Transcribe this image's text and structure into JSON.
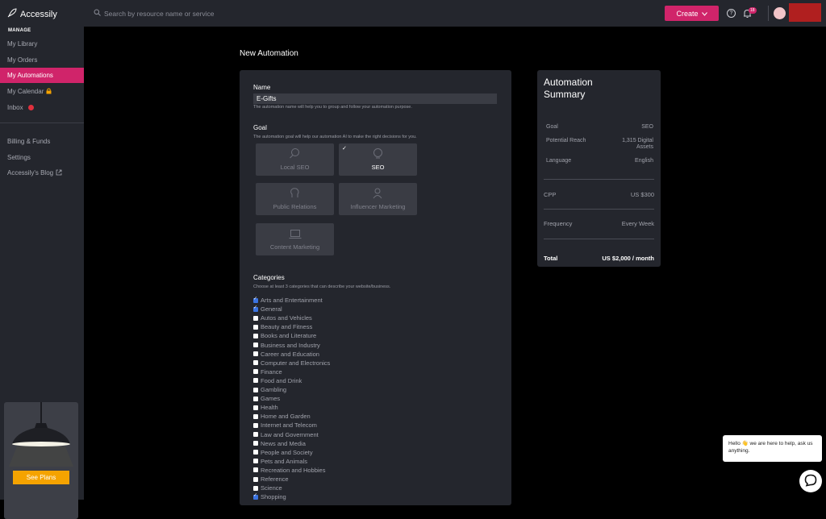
{
  "brand": {
    "name": "Accessily"
  },
  "search": {
    "placeholder": "Search by resource name or service"
  },
  "header": {
    "create_label": "Create",
    "notifications_count": "18"
  },
  "sidebar": {
    "section_label": "MANAGE",
    "items": [
      {
        "label": "My Library"
      },
      {
        "label": "My Orders"
      },
      {
        "label": "My Automations",
        "active": true
      },
      {
        "label": "My Calendar"
      },
      {
        "label": "Inbox"
      }
    ],
    "secondary_items": [
      {
        "label": "Billing & Funds"
      },
      {
        "label": "Settings"
      },
      {
        "label": "Accessily's Blog"
      }
    ],
    "promo_button": "See Plans"
  },
  "page": {
    "title": "New Automation"
  },
  "form": {
    "name_label": "Name",
    "name_value": "E-Gifts",
    "name_hint": "The automation name will help you to group and follow your automation purpose.",
    "goal_label": "Goal",
    "goal_hint": "The automation goal will help our automation AI to make the right decisions for you.",
    "goals": [
      {
        "label": "Local SEO",
        "selected": false
      },
      {
        "label": "SEO",
        "selected": true
      },
      {
        "label": "Public Relations",
        "selected": false
      },
      {
        "label": "Influencer Marketing",
        "selected": false
      },
      {
        "label": "Content Marketing",
        "selected": false
      }
    ],
    "categories_label": "Categories",
    "categories_hint": "Choose at least 3 categories that can describe your website/business.",
    "categories": [
      {
        "label": "Arts and Entertainment",
        "checked": true
      },
      {
        "label": "General",
        "checked": true
      },
      {
        "label": "Autos and Vehicles",
        "checked": false
      },
      {
        "label": "Beauty and Fitness",
        "checked": false
      },
      {
        "label": "Books and Literature",
        "checked": false
      },
      {
        "label": "Business and Industry",
        "checked": false
      },
      {
        "label": "Career and Education",
        "checked": false
      },
      {
        "label": "Computer and Electronics",
        "checked": false
      },
      {
        "label": "Finance",
        "checked": false
      },
      {
        "label": "Food and Drink",
        "checked": false
      },
      {
        "label": "Gambling",
        "checked": false
      },
      {
        "label": "Games",
        "checked": false
      },
      {
        "label": "Health",
        "checked": false
      },
      {
        "label": "Home and Garden",
        "checked": false
      },
      {
        "label": "Internet and Telecom",
        "checked": false
      },
      {
        "label": "Law and Government",
        "checked": false
      },
      {
        "label": "News and Media",
        "checked": false
      },
      {
        "label": "People and Society",
        "checked": false
      },
      {
        "label": "Pets and Animals",
        "checked": false
      },
      {
        "label": "Recreation and Hobbies",
        "checked": false
      },
      {
        "label": "Reference",
        "checked": false
      },
      {
        "label": "Science",
        "checked": false
      },
      {
        "label": "Shopping",
        "checked": true
      }
    ]
  },
  "summary": {
    "title": "Automation Summary",
    "goal_label": "Goal",
    "goal_value": "SEO",
    "reach_label": "Potential Reach",
    "reach_value": "1,315 Digital Assets",
    "language_label": "Language",
    "language_value": "English",
    "cpp_label": "CPP",
    "cpp_value": "US $300",
    "frequency_label": "Frequency",
    "frequency_value": "Every Week",
    "total_label": "Total",
    "total_value": "US $2,000 / month"
  },
  "chat": {
    "message": "Hello 👋 we are here to help, ask us anything."
  },
  "colors": {
    "accent": "#d0246a",
    "promo_button": "#f5a300",
    "panel": "#24262d"
  }
}
